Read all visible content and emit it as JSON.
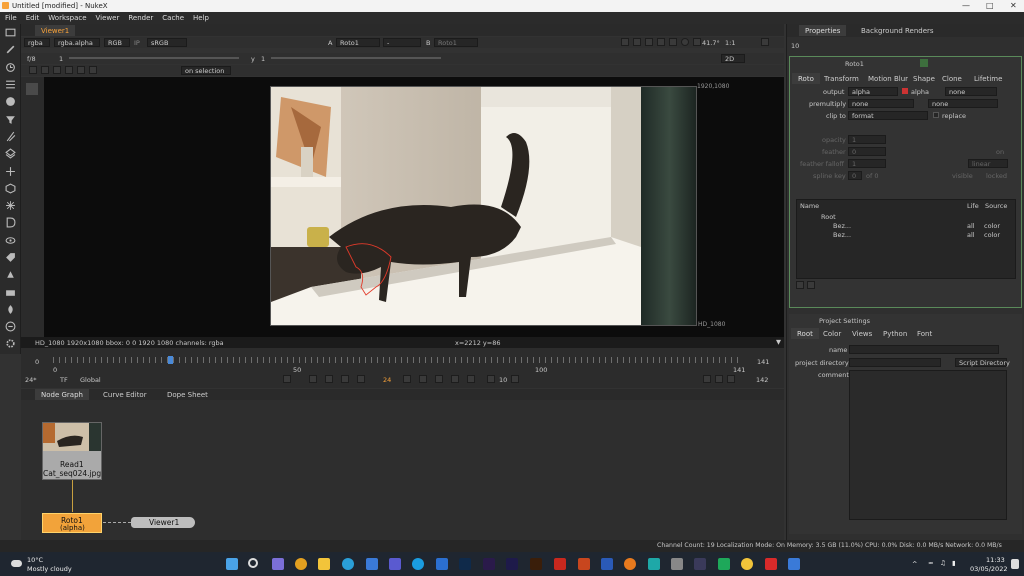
{
  "window": {
    "title": "Untitled [modified] - NukeX"
  },
  "menu": [
    "File",
    "Edit",
    "Workspace",
    "Viewer",
    "Render",
    "Cache",
    "Help"
  ],
  "viewer_tabs": {
    "active": "Viewer1"
  },
  "viewer_controls": {
    "channels": "rgba",
    "alpha": "rgba.alpha",
    "rgb": "RGB",
    "ip": "IP",
    "lut": "sRGB",
    "a_label": "A",
    "a_input": "Roto1",
    "dash": "-",
    "b_label": "B",
    "b_input": "Roto1",
    "zoom": "41.7°",
    "ratio": "1:1",
    "frame_prefix": "f/8",
    "gain": "1",
    "y_label": "y",
    "gamma": "1",
    "mode": "2D",
    "on_selection": "on selection"
  },
  "viewer": {
    "format_top_right": "1920,1080",
    "format_bottom_right": "HD_1080",
    "info_left": "HD_1080 1920x1080  bbox: 0 0 1920 1080 channels: rgba",
    "info_coords": "x=2212 y=86"
  },
  "timeline": {
    "start": "0",
    "mid": "50",
    "hundred": "100",
    "end": "141",
    "end_right": "141",
    "fps": "24*",
    "tf": "TF",
    "scope": "Global",
    "current_frame": "24",
    "step": "10",
    "last": "142"
  },
  "bottom_tabs": [
    "Node Graph",
    "Curve Editor",
    "Dope Sheet"
  ],
  "nodes": {
    "read": {
      "name": "Read1",
      "file": "Cat_seq024.jpg"
    },
    "roto": {
      "name": "Roto1",
      "sub": "(alpha)"
    },
    "viewer": {
      "name": "Viewer1"
    }
  },
  "properties": {
    "tabs": [
      "Properties",
      "Background Renders"
    ],
    "count": "10",
    "node_name": "Roto1",
    "subtabs": [
      "Roto",
      "Transform",
      "Motion Blur",
      "Shape",
      "Clone",
      "Lifetime"
    ],
    "output_label": "output",
    "output_value": "alpha",
    "output_alpha": "alpha",
    "output_none": "none",
    "premult_label": "premultiply",
    "premult_value": "none",
    "premult_none": "none",
    "clip_label": "clip to",
    "clip_value": "format",
    "replace_label": "replace",
    "opacity_label": "opacity",
    "opacity_value": "1",
    "feather_label": "feather",
    "feather_value": "0",
    "feather_on": "on",
    "falloff_label": "feather falloff",
    "falloff_value": "1",
    "falloff_type": "linear",
    "spline_label": "spline key",
    "spline_value": "0",
    "spline_of": "of 0",
    "visible_label": "visible",
    "locked_label": "locked",
    "tree_headers": {
      "name": "Name",
      "life": "Life",
      "source": "Source"
    },
    "tree_rows": [
      {
        "name": "Root",
        "life": "",
        "source": ""
      },
      {
        "name": "Bez...",
        "life": "all",
        "source": "color"
      },
      {
        "name": "Bez...",
        "life": "all",
        "source": "color"
      }
    ]
  },
  "project_settings": {
    "title": "Project Settings",
    "tabs": [
      "Root",
      "Color",
      "Views",
      "Python",
      "Font"
    ],
    "name_label": "name",
    "dir_label": "project directory",
    "dir_button": "Script Directory",
    "comment_label": "comment"
  },
  "status": "Channel Count: 19  Localization Mode: On  Memory: 3.5 GB (11.0%)  CPU: 0.0%  Disk: 0.0 MB/s  Network: 0.0 MB/s",
  "taskbar": {
    "temp": "10°C",
    "weather": "Mostly cloudy",
    "time": "11:33",
    "date": "03/05/2022"
  },
  "colors": {
    "accent_orange": "#f7a23a",
    "roto_node": "#f2a33a",
    "panel": "#2f2f2f",
    "viewer_bg": "#0c0c0c"
  }
}
